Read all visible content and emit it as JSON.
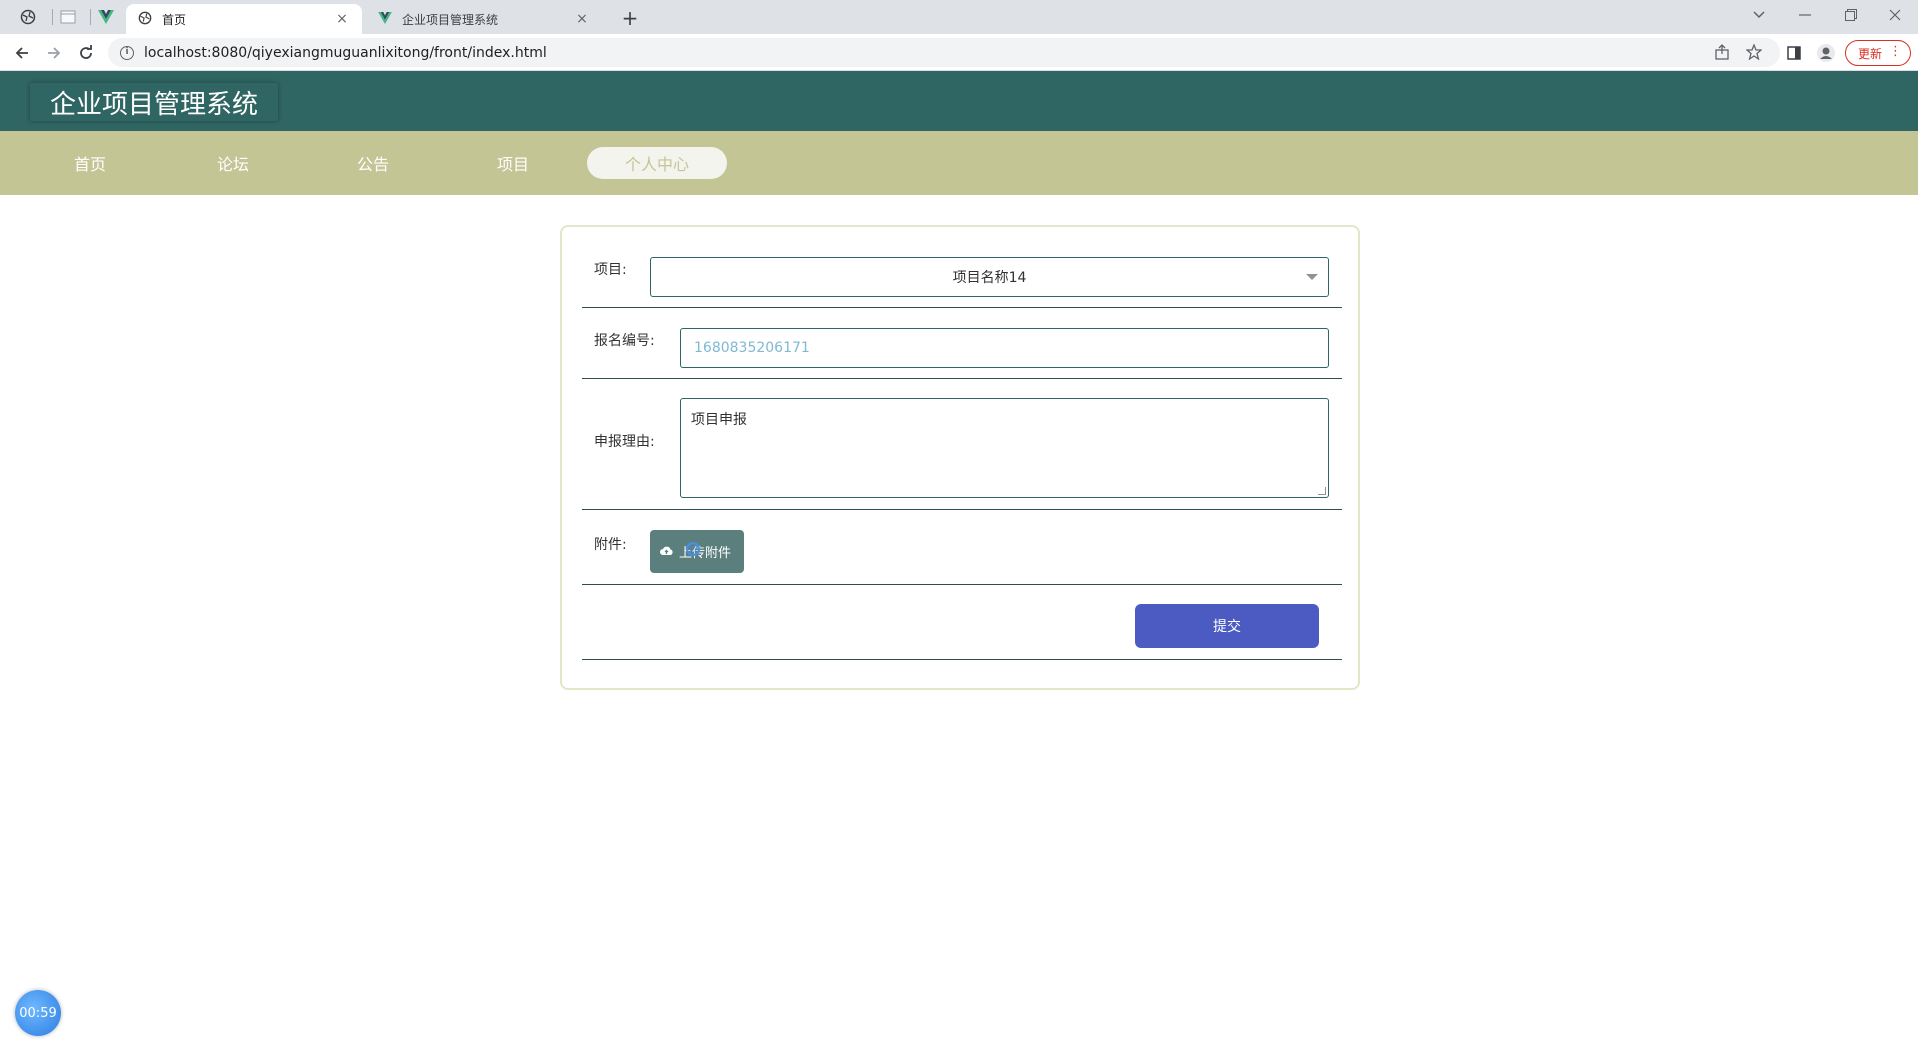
{
  "browser": {
    "tabs": [
      {
        "title": "首页",
        "active": true
      },
      {
        "title": "企业项目管理系统",
        "active": false
      }
    ],
    "close_glyph": "×",
    "new_tab_glyph": "+",
    "url": "localhost:8080/qiyexiangmuguanlixitong/front/index.html",
    "update_label": "更新",
    "menu_glyph": "⋮"
  },
  "app": {
    "title": "企业项目管理系统",
    "nav": [
      {
        "label": "首页"
      },
      {
        "label": "论坛"
      },
      {
        "label": "公告"
      },
      {
        "label": "项目"
      },
      {
        "label": "个人中心"
      }
    ]
  },
  "form": {
    "project_label": "项目:",
    "project_value": "项目名称14",
    "number_label": "报名编号:",
    "number_placeholder": "1680835206171",
    "reason_label": "申报理由:",
    "reason_value": "项目申报",
    "attachment_label": "附件:",
    "upload_label": "上传附件",
    "submit_label": "提交"
  },
  "timer": "00:59",
  "colors": {
    "header_bg": "#2f6562",
    "nav_bg": "#c4c595",
    "upload_bg": "#5a7f7c",
    "submit_bg": "#4c5bc2"
  }
}
